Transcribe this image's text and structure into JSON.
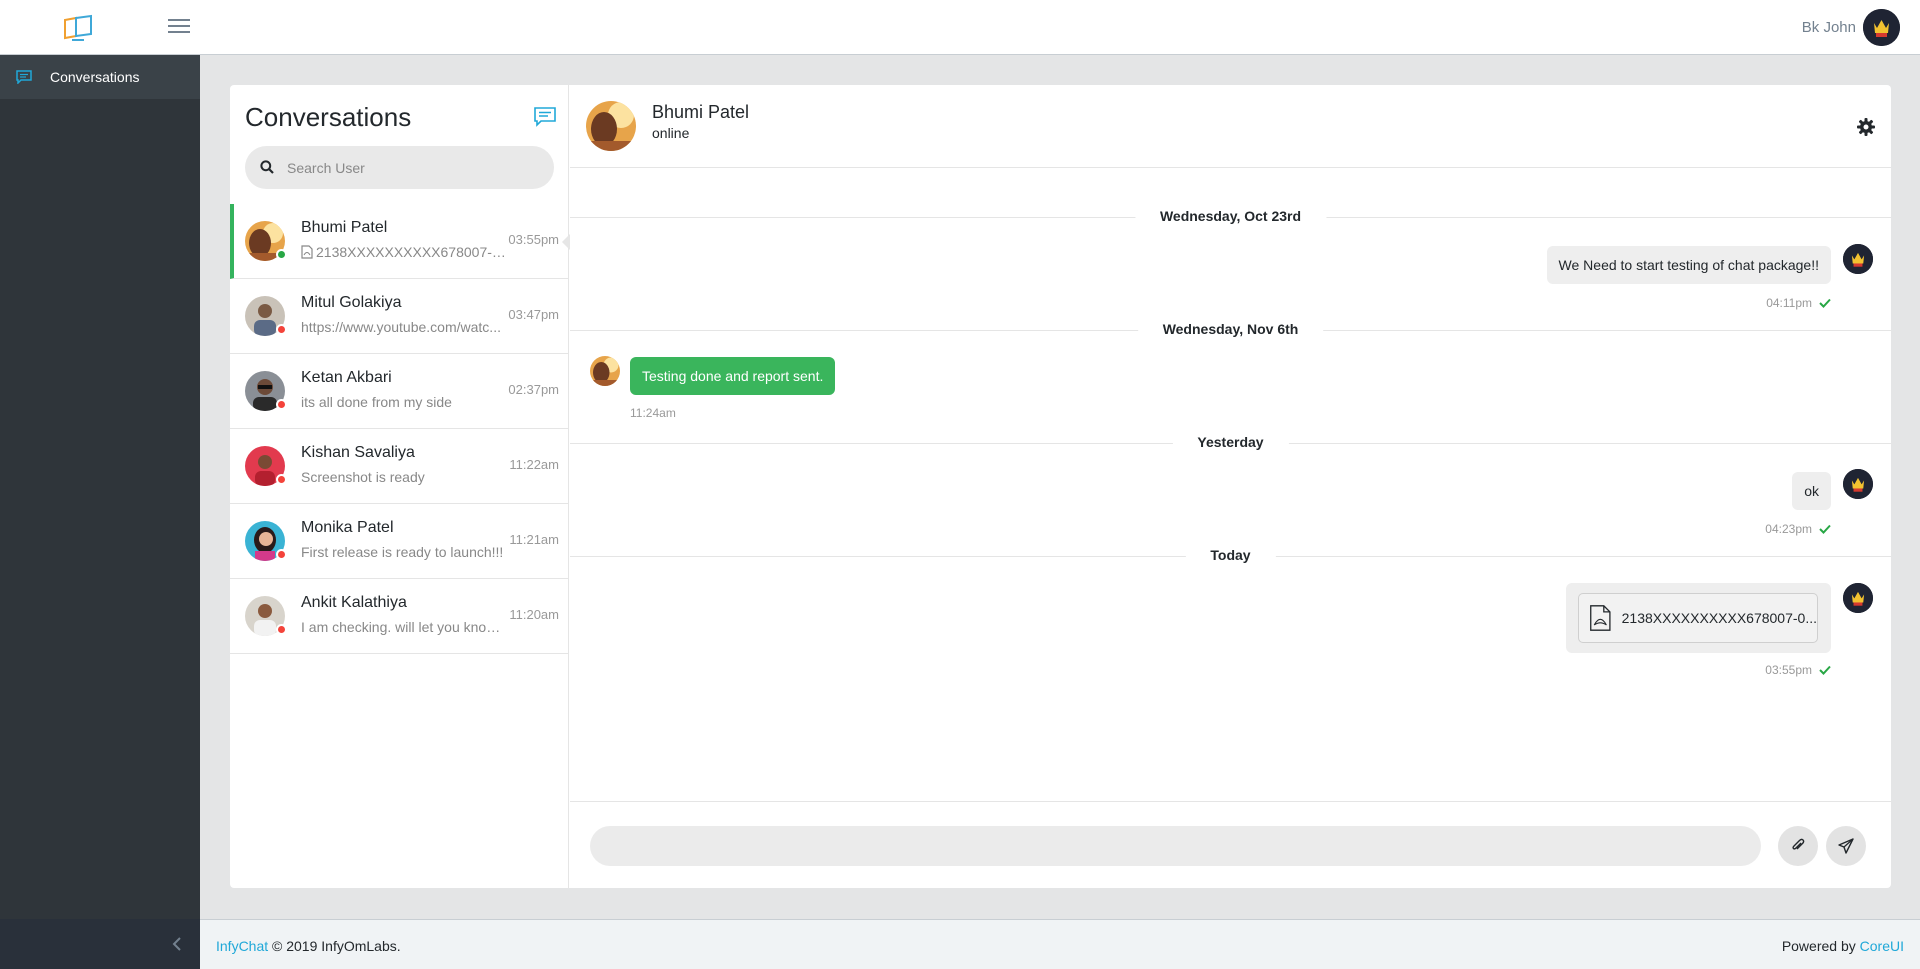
{
  "header": {
    "user_name": "Bk John",
    "user_avatar": "crown-avatar"
  },
  "sidebar": {
    "items": [
      {
        "label": "Conversations",
        "icon": "chat-icon"
      }
    ]
  },
  "conversations": {
    "title": "Conversations",
    "search_placeholder": "Search User",
    "items": [
      {
        "name": "Bhumi Patel",
        "last_message": "2138XXXXXXXXXX678007-08-...",
        "time": "03:55pm",
        "status": "online",
        "status_color": "#28a745",
        "active": true,
        "icon": "file-pdf-icon"
      },
      {
        "name": "Mitul Golakiya",
        "last_message": "https://www.youtube.com/watc...",
        "time": "03:47pm",
        "status": "offline",
        "status_color": "#f4433a"
      },
      {
        "name": "Ketan Akbari",
        "last_message": "its all done from my side",
        "time": "02:37pm",
        "status": "offline",
        "status_color": "#f4433a"
      },
      {
        "name": "Kishan Savaliya",
        "last_message": "Screenshot is ready",
        "time": "11:22am",
        "status": "offline",
        "status_color": "#f4433a"
      },
      {
        "name": "Monika Patel",
        "last_message": "First release is ready to launch!!!",
        "time": "11:21am",
        "status": "offline",
        "status_color": "#f4433a"
      },
      {
        "name": "Ankit Kalathiya",
        "last_message": "I am checking. will let you know...",
        "time": "11:20am",
        "status": "offline",
        "status_color": "#f4433a"
      }
    ]
  },
  "chat": {
    "name": "Bhumi Patel",
    "status": "online",
    "dates": [
      "Wednesday, Oct 23rd",
      "Wednesday, Nov 6th",
      "Yesterday",
      "Today"
    ],
    "messages": [
      {
        "direction": "out",
        "text": "We Need to start testing of chat package!!",
        "time": "04:11pm"
      },
      {
        "direction": "in",
        "text": "Testing done and report sent.",
        "time": "11:24am"
      },
      {
        "direction": "out",
        "text": "ok",
        "time": "04:23pm"
      },
      {
        "direction": "out",
        "type": "file",
        "text": "2138XXXXXXXXXX678007-0...",
        "time": "03:55pm"
      }
    ],
    "composer_placeholder": ""
  },
  "footer": {
    "brand": "InfyChat",
    "copyright": "© 2019 InfyOmLabs.",
    "powered_by": "Powered by",
    "powered_link": "CoreUI"
  },
  "colors": {
    "accent": "#20a8d8",
    "online": "#28a745",
    "offline": "#f4433a",
    "incoming_bubble": "#3ab55c",
    "sidebar_bg": "#2f353a"
  }
}
